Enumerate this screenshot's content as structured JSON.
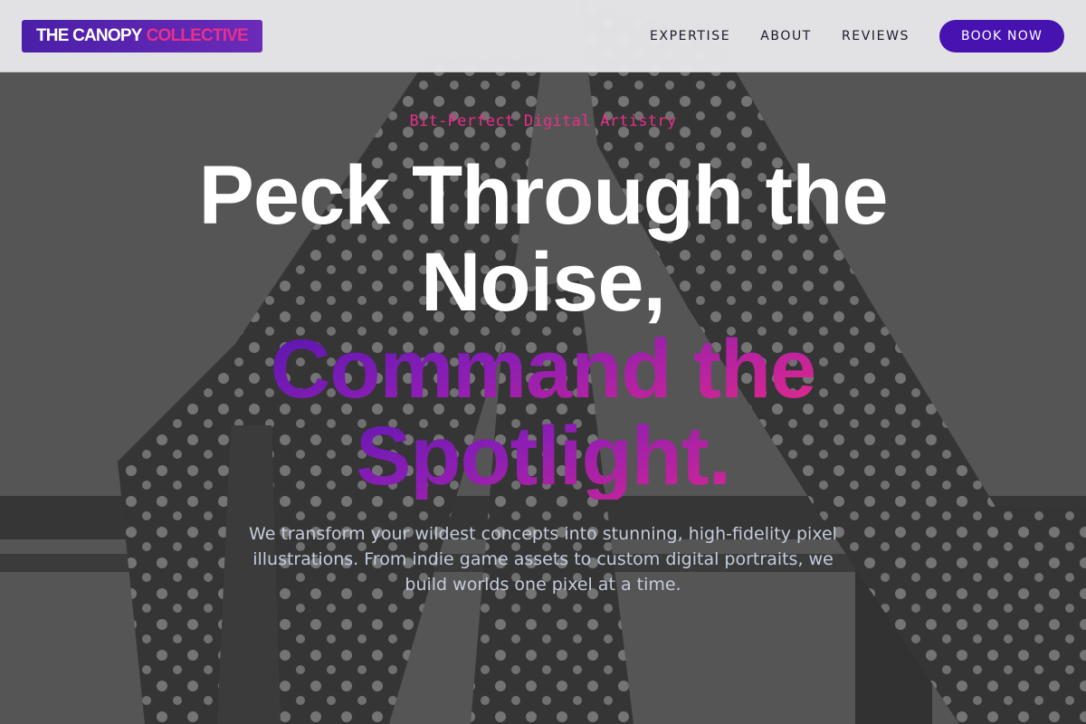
{
  "header": {
    "logo_primary": "THE CANOPY",
    "logo_accent": "COLLECTIVE",
    "nav": [
      "EXPERTISE",
      "ABOUT",
      "REVIEWS"
    ],
    "cta_label": "BOOK NOW"
  },
  "hero": {
    "tagline": "Bit-Perfect Digital Artistry",
    "headline_line1": "Peck Through the",
    "headline_line2": "Noise,",
    "headline_line3": "Command the",
    "headline_line4": "Spotlight.",
    "subtitle": "We transform your wildest concepts into stunning, high-fidelity pixel illustrations. From indie game assets to custom digital portraits, we build worlds one pixel at a time."
  },
  "colors": {
    "brand_purple": "#4612b0",
    "accent_pink": "#e8308a",
    "header_bg": "#e8e8ea",
    "overlay_gray": "#5a5a5a"
  }
}
